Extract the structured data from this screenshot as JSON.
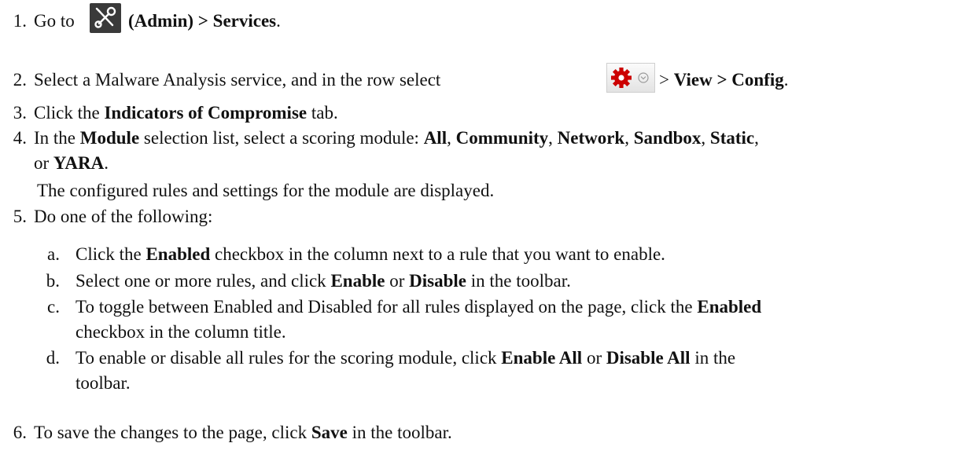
{
  "steps": [
    {
      "number": "1.",
      "pre": "Go to ",
      "bold": "(Admin) > Services",
      "post": "."
    },
    {
      "number": "2.",
      "text": "Select a Malware Analysis service, and in the row select ",
      "gt": ">",
      "bold": "View > Config",
      "post": "."
    },
    {
      "number": "3.",
      "pre": "Click the ",
      "bold": "Indicators of Compromise",
      "post": " tab."
    },
    {
      "number": "4.",
      "pre": "In the ",
      "bold1": "Module",
      "mid": " selection list, select a scoring module: ",
      "m_all": "All",
      "m_community": "Community",
      "m_network": "Network",
      "m_sandbox": "Sandbox",
      "m_static": "Static",
      "or": "or ",
      "m_yara": "YARA",
      "end": ".",
      "note": "The configured rules and settings for the module are displayed."
    },
    {
      "number": "5.",
      "text": "Do one of the following:"
    },
    {
      "number": "6.",
      "pre": "To save the changes to the page, click ",
      "bold": "Save",
      "post": " in the toolbar."
    }
  ],
  "substeps": [
    {
      "letter": "a.",
      "pre": "Click the ",
      "bold": "Enabled",
      "post": " checkbox in the column next to a rule that you want to enable."
    },
    {
      "letter": "b.",
      "pre": "Select one or more rules, and click ",
      "bold1": "Enable",
      "mid": " or ",
      "bold2": "Disable",
      "post": " in the toolbar."
    },
    {
      "letter": "c.",
      "pre": "To toggle between Enabled and Disabled for all rules displayed on the page, click the ",
      "bold": "Enabled",
      "post2": "checkbox in the column title."
    },
    {
      "letter": "d.",
      "pre": "To enable or disable all rules for the scoring module, click ",
      "bold1": "Enable All",
      "mid": " or ",
      "bold2": "Disable All",
      "post": " in the",
      "post2": "toolbar."
    }
  ],
  "icons": {
    "admin": "admin-tools-icon",
    "gear": "gear-icon",
    "dropdown": "chevron-down-icon"
  },
  "colors": {
    "text": "#111111",
    "gear": "#cc0000",
    "admin_bg": "#3a3a3a"
  }
}
